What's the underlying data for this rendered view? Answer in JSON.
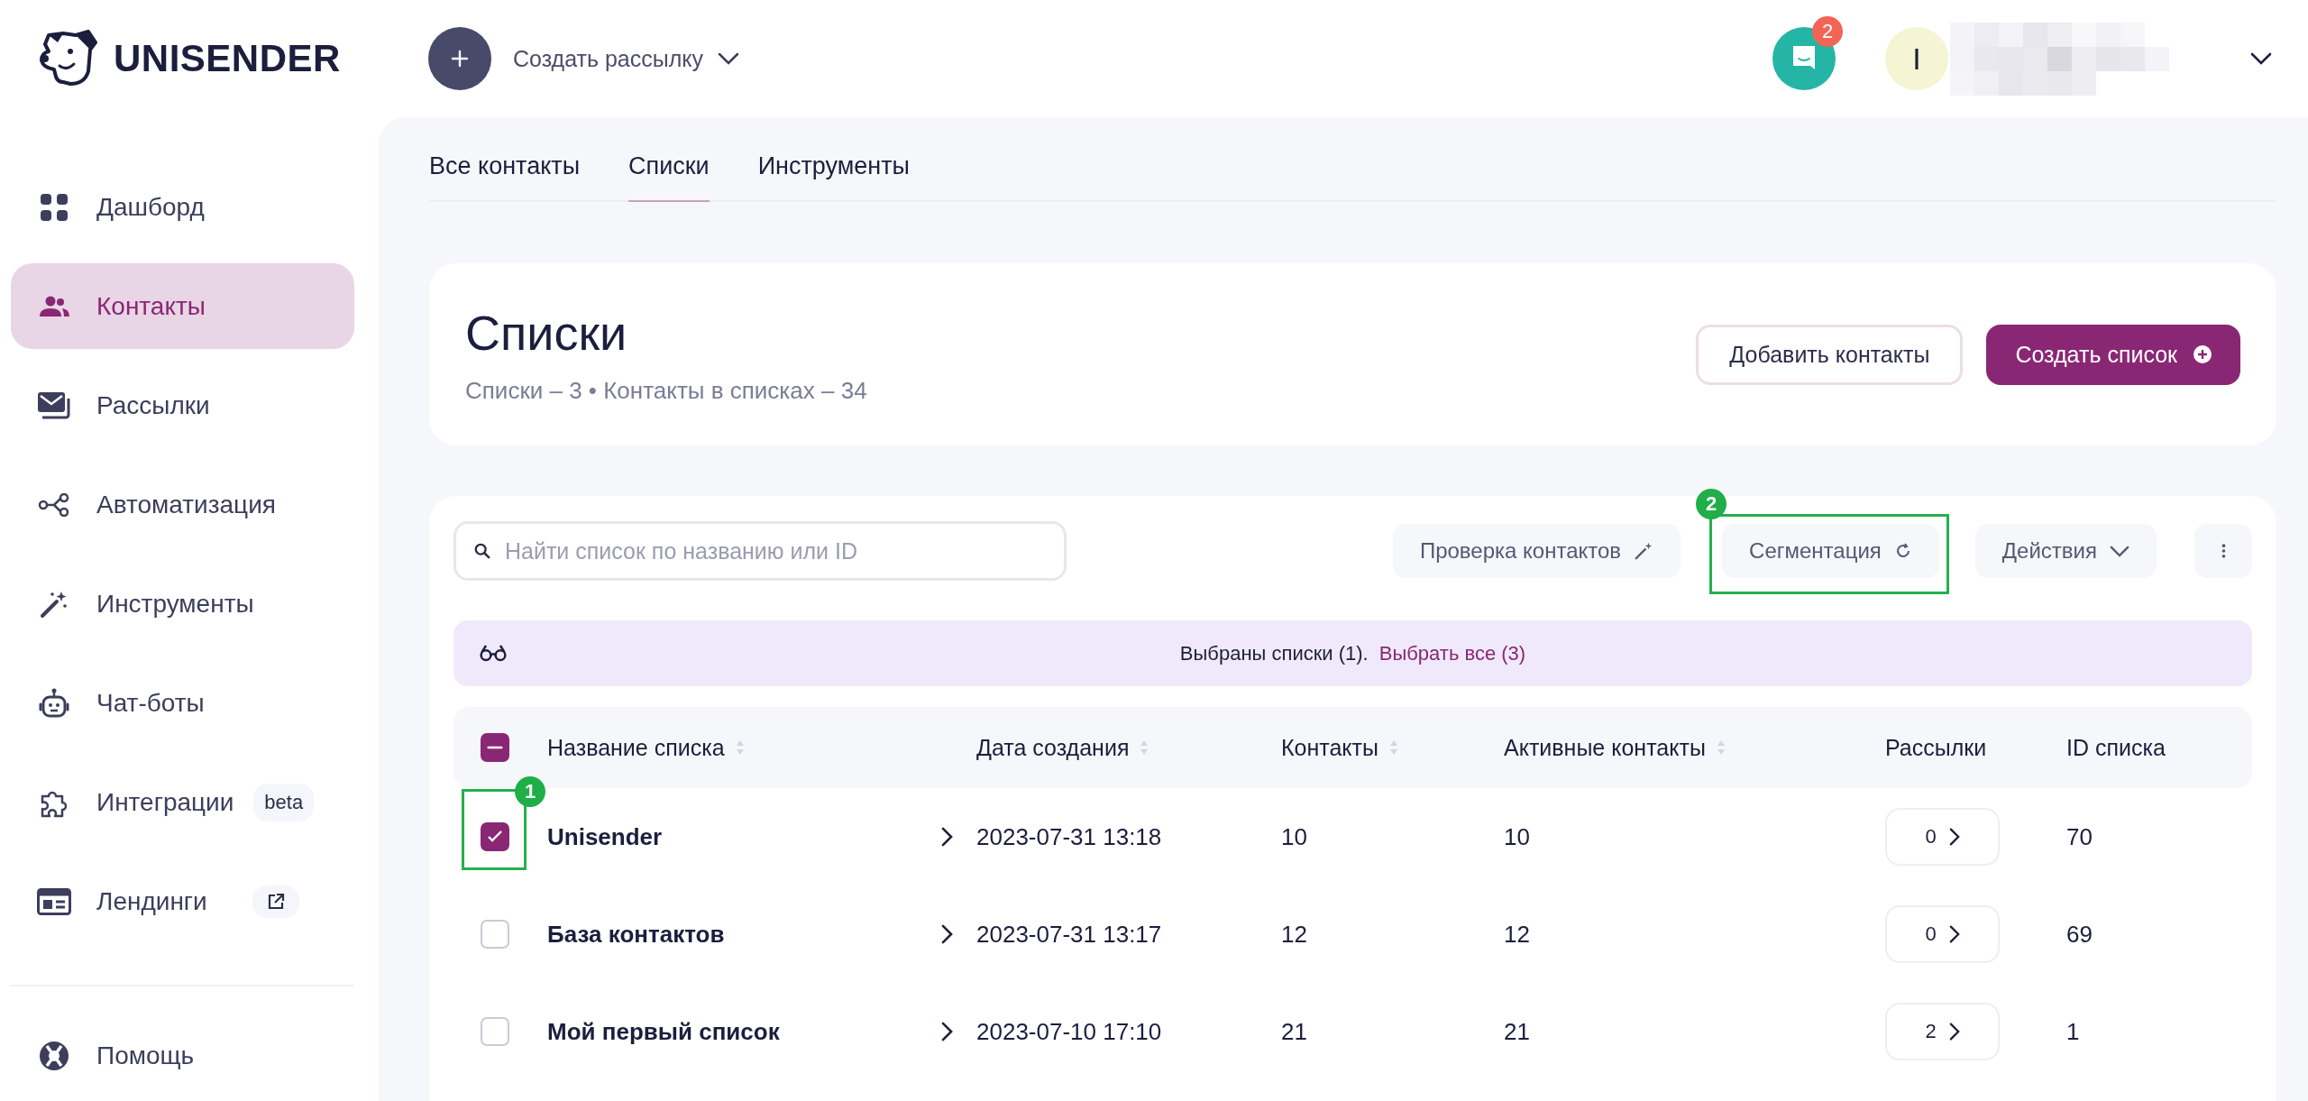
{
  "header": {
    "logo": "UNISENDER",
    "create_menu": {
      "label": "Создать рассылку"
    },
    "chat": {
      "badge": "2"
    },
    "avatar": {
      "initial": "I"
    }
  },
  "sidebar": {
    "items": [
      {
        "label": "Дашборд",
        "selected": false
      },
      {
        "label": "Контакты",
        "selected": true
      },
      {
        "label": "Рассылки",
        "selected": false
      },
      {
        "label": "Автоматизация",
        "selected": false
      },
      {
        "label": "Инструменты",
        "selected": false
      },
      {
        "label": "Чат-боты",
        "selected": false
      },
      {
        "label": "Интеграции",
        "selected": false,
        "badge": "beta"
      },
      {
        "label": "Лендинги",
        "selected": false,
        "external": true
      }
    ],
    "footer": {
      "label": "Помощь"
    }
  },
  "tabs": [
    {
      "label": "Все контакты",
      "selected": false
    },
    {
      "label": "Списки",
      "selected": true
    },
    {
      "label": "Инструменты",
      "selected": false
    }
  ],
  "page": {
    "title": "Списки",
    "subtitle": "Списки – 3 • Контакты в списках – 34",
    "add_button": "Добавить контакты",
    "create_button": "Создать список"
  },
  "toolbar": {
    "search": {
      "placeholder": "Найти список по названию или ID"
    },
    "check_button": "Проверка контактов",
    "segment_button": {
      "label": "Сегментация",
      "callout": "2"
    },
    "actions_button": "Действия"
  },
  "selection_banner": {
    "text": "Выбраны списки (1).",
    "link": "Выбрать все (3)"
  },
  "table": {
    "header_checkbox": {
      "indeterminate": true
    },
    "columns": [
      {
        "label": "Название списка",
        "sortable": true
      },
      {
        "label": "Дата создания",
        "sortable": true
      },
      {
        "label": "Контакты",
        "sortable": true
      },
      {
        "label": "Активные контакты",
        "sortable": true
      },
      {
        "label": "Рассылки",
        "sortable": false
      },
      {
        "label": "ID списка",
        "sortable": false
      }
    ],
    "rows": [
      {
        "selected": true,
        "callout": "1",
        "name": "Unisender",
        "created": "2023-07-31 13:18",
        "contacts": "10",
        "active_contacts": "10",
        "mailings": "0",
        "id": "70"
      },
      {
        "selected": false,
        "name": "База контактов",
        "created": "2023-07-31 13:17",
        "contacts": "12",
        "active_contacts": "12",
        "mailings": "0",
        "id": "69"
      },
      {
        "selected": false,
        "name": "Мой первый список",
        "created": "2023-07-10 17:10",
        "contacts": "21",
        "active_contacts": "21",
        "mailings": "2",
        "id": "1"
      }
    ]
  }
}
